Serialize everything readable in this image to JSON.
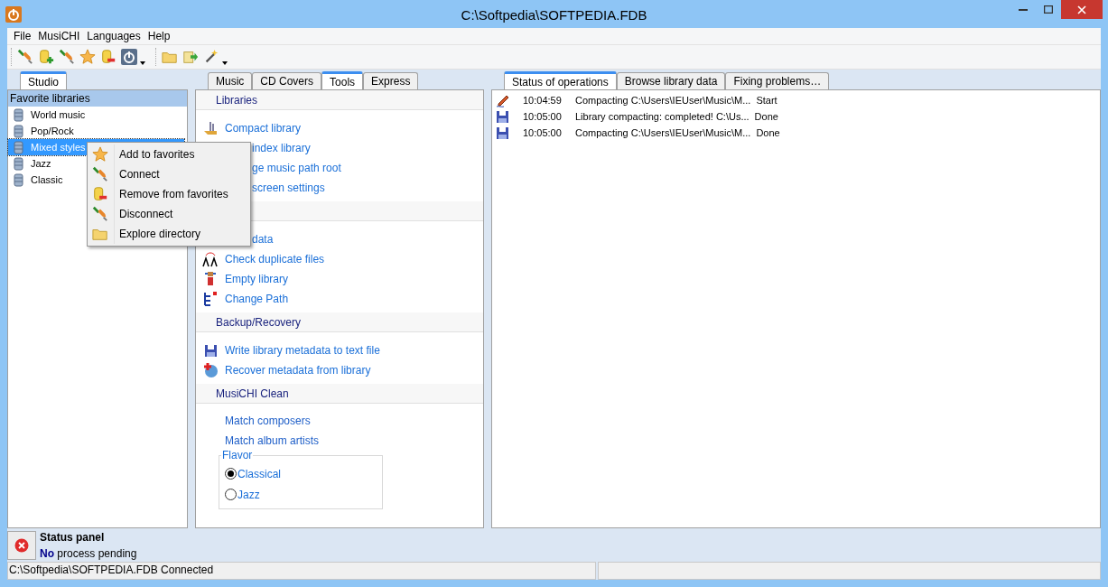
{
  "window": {
    "title": "C:\\Softpedia\\SOFTPEDIA.FDB"
  },
  "menu": [
    "File",
    "MusiCHI",
    "Languages",
    "Help"
  ],
  "left_tabs": [
    {
      "label": "Studio",
      "selected": true
    }
  ],
  "favorites": {
    "title": "Favorite libraries",
    "items": [
      {
        "label": "World music",
        "selected": false
      },
      {
        "label": "Pop/Rock",
        "selected": false
      },
      {
        "label": "Mixed styles",
        "selected": true
      },
      {
        "label": "Jazz",
        "selected": false
      },
      {
        "label": "Classic",
        "selected": false
      }
    ]
  },
  "context_menu": [
    "Add to favorites",
    "Connect",
    "Remove from favorites",
    "Disconnect",
    "Explore directory"
  ],
  "middle_tabs": [
    {
      "label": "Music",
      "selected": false
    },
    {
      "label": "CD Covers",
      "selected": false
    },
    {
      "label": "Tools",
      "selected": true
    },
    {
      "label": "Express",
      "selected": false
    }
  ],
  "tools": {
    "sections": [
      {
        "title": "Libraries",
        "items": [
          {
            "label": "Compact library",
            "kind": "link"
          },
          {
            "label": "index library",
            "kind": "partial"
          },
          {
            "label": "ge music path root",
            "kind": "partial"
          },
          {
            "label": "screen settings",
            "kind": "partial"
          }
        ]
      },
      {
        "items": [
          {
            "label": "data",
            "kind": "partial"
          },
          {
            "label": "Check duplicate files",
            "kind": "link"
          },
          {
            "label": "Empty library",
            "kind": "link"
          },
          {
            "label": "Change Path",
            "kind": "link"
          }
        ]
      },
      {
        "title": "Backup/Recovery",
        "items": [
          {
            "label": "Write library metadata to text file",
            "kind": "link"
          },
          {
            "label": "Recover metadata from library",
            "kind": "link"
          }
        ]
      },
      {
        "title": "MusiCHI Clean",
        "items": [
          {
            "label": "Match composers",
            "kind": "plain"
          },
          {
            "label": "Match album artists",
            "kind": "plain"
          }
        ]
      }
    ],
    "flavor": {
      "legend": "Flavor",
      "options": [
        {
          "label": "Classical",
          "selected": true
        },
        {
          "label": "Jazz",
          "selected": false
        }
      ]
    }
  },
  "right_tabs": [
    {
      "label": "Status of operations",
      "selected": true
    },
    {
      "label": "Browse library data",
      "selected": false
    },
    {
      "label": "Fixing problems…",
      "selected": false
    }
  ],
  "operations": [
    {
      "kind": "edit",
      "time": "10:04:59",
      "message": "Compacting C:\\Users\\IEUser\\Music\\M...",
      "status": "Start"
    },
    {
      "kind": "save",
      "time": "10:05:00",
      "message": "Library compacting: completed! C:\\Us...",
      "status": "Done"
    },
    {
      "kind": "save",
      "time": "10:05:00",
      "message": "Compacting C:\\Users\\IEUser\\Music\\M...",
      "status": "Done"
    }
  ],
  "status_panel": {
    "title": "Status panel",
    "message": "**No** process pending"
  },
  "status_bar": "C:\\Softpedia\\SOFTPEDIA.FDB Connected"
}
